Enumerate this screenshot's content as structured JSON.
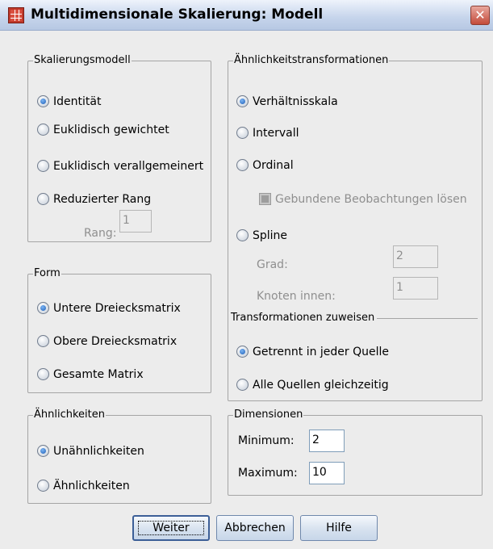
{
  "window": {
    "title": "Multidimensionale Skalierung: Modell",
    "close_glyph": "✕",
    "app_icon": "table-icon"
  },
  "groups": {
    "model": {
      "label": "Skalierungsmodell",
      "options": [
        "Identität",
        "Euklidisch gewichtet",
        "Euklidisch verallgemeinert",
        "Reduzierter Rang"
      ],
      "selected": "Identität",
      "rank_label": "Rang:",
      "rank_value": "1"
    },
    "shape": {
      "label": "Form",
      "options": [
        "Untere Dreiecksmatrix",
        "Obere Dreiecksmatrix",
        "Gesamte Matrix"
      ],
      "selected": "Untere Dreiecksmatrix"
    },
    "proximities": {
      "label": "Ähnlichkeiten",
      "options": [
        "Unähnlichkeiten",
        "Ähnlichkeiten"
      ],
      "selected": "Unähnlichkeiten"
    },
    "transformations": {
      "label": "Ähnlichkeitstransformationen",
      "options": [
        "Verhältnisskala",
        "Intervall",
        "Ordinal",
        "Spline"
      ],
      "selected": "Verhältnisskala",
      "ties_label": "Gebundene Beobachtungen lösen",
      "degree_label": "Grad:",
      "degree_value": "2",
      "knots_label": "Knoten innen:",
      "knots_value": "1"
    },
    "apply": {
      "label": "Transformationen zuweisen",
      "options": [
        "Getrennt in jeder Quelle",
        "Alle Quellen gleichzeitig"
      ],
      "selected": "Getrennt in jeder Quelle"
    },
    "dimensions": {
      "label": "Dimensionen",
      "min_label": "Minimum:",
      "min_value": "2",
      "max_label": "Maximum:",
      "max_value": "10"
    }
  },
  "buttons": {
    "continue": "Weiter",
    "cancel": "Abbrechen",
    "help": "Hilfe"
  },
  "colors": {
    "accent": "#1d5fb8",
    "dialog_bg": "#ececec",
    "title_bg": "#c5d4eb",
    "close_button": "#c44b3a"
  }
}
